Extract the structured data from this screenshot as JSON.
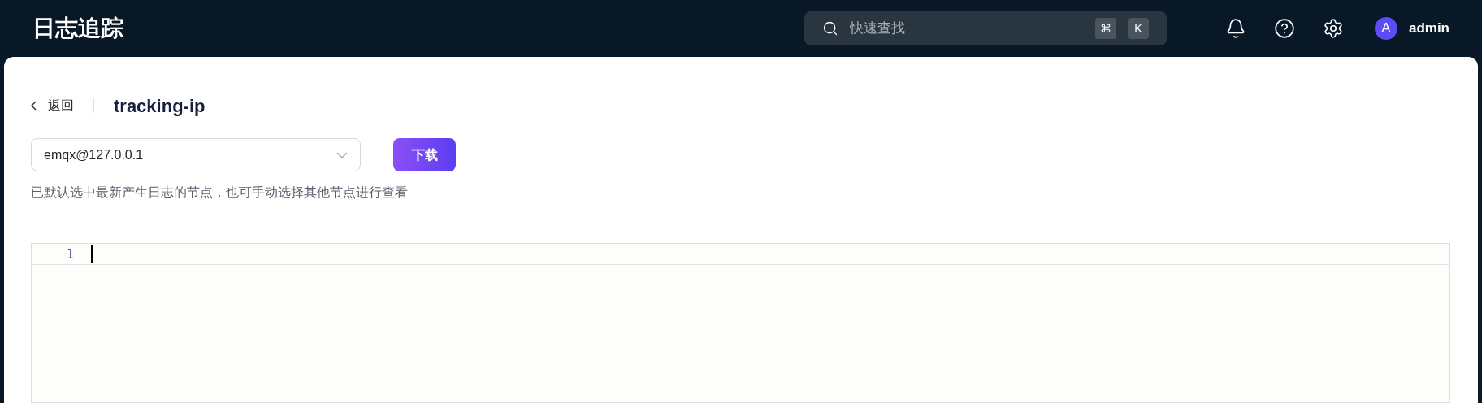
{
  "header": {
    "title": "日志追踪",
    "search": {
      "placeholder": "快速查找",
      "keys": [
        "⌘",
        "K"
      ]
    },
    "user": {
      "avatar": "A",
      "name": "admin"
    }
  },
  "page": {
    "back": "返回",
    "title": "tracking-ip",
    "node_select": {
      "value": "emqx@127.0.0.1"
    },
    "download_button": "下载",
    "hint": "已默认选中最新产生日志的节点，也可手动选择其他节点进行查看"
  },
  "editor": {
    "lines": [
      {
        "number": "1"
      }
    ]
  }
}
